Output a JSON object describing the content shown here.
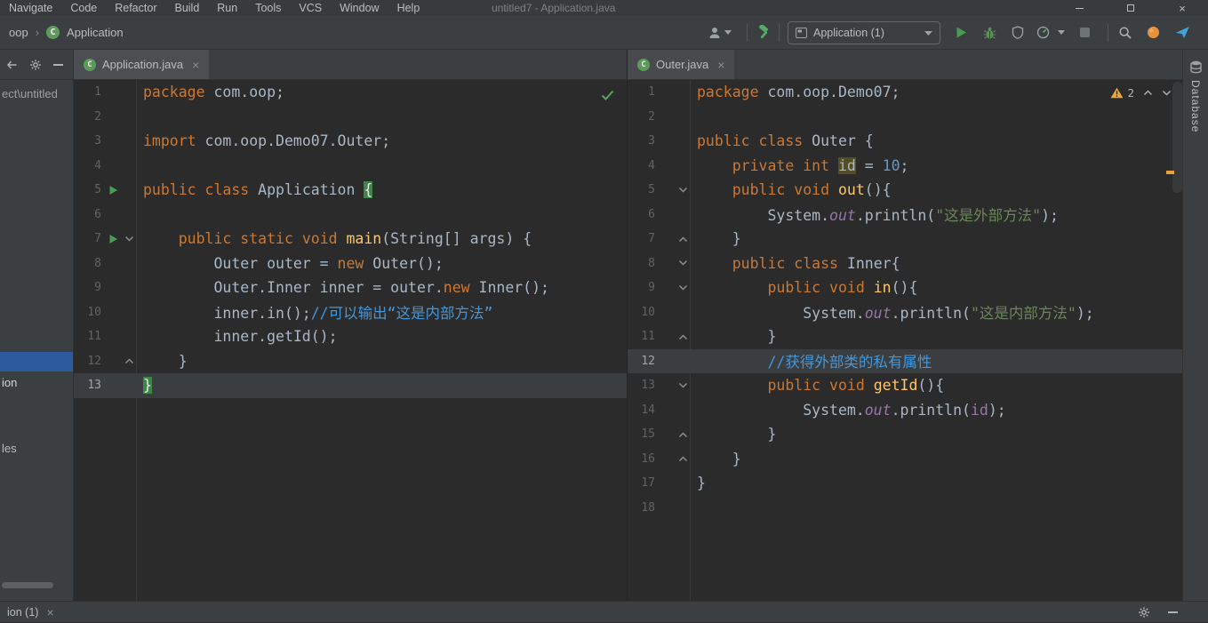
{
  "window": {
    "title": "untitled7 - Application.java",
    "menu_items": [
      "Navigate",
      "Code",
      "Refactor",
      "Build",
      "Run",
      "Tools",
      "VCS",
      "Window",
      "Help"
    ]
  },
  "icons": {
    "class_letter": "C"
  },
  "toolbar": {
    "breadcrumb_module": "oop",
    "breadcrumb_separator": "›",
    "breadcrumb_class": "Application",
    "run_config_label": "Application (1)"
  },
  "project_panel": {
    "top_item": "ect\\untitled",
    "mid_item": "ion",
    "low_item": "les"
  },
  "editor": {
    "left_pane": {
      "tab_label": "Application.java",
      "tab_close": "×",
      "current_line": 13,
      "run_lines": [
        5,
        7
      ],
      "fold_down_lines": [
        7
      ],
      "fold_up_lines": [
        12
      ],
      "lines": [
        [
          [
            "k",
            "package"
          ],
          [
            "d",
            " com.oop;"
          ]
        ],
        [],
        [
          [
            "k",
            "import"
          ],
          [
            "d",
            " com.oop.Demo07.Outer;"
          ]
        ],
        [],
        [
          [
            "k",
            "public class"
          ],
          [
            "d",
            " Application "
          ],
          [
            "bm",
            "{"
          ]
        ],
        [],
        [
          [
            "d",
            "    "
          ],
          [
            "k",
            "public static void"
          ],
          [
            "d",
            " "
          ],
          [
            "m",
            "main"
          ],
          [
            "d",
            "(String[] args) {"
          ]
        ],
        [
          [
            "d",
            "        Outer outer = "
          ],
          [
            "k",
            "new"
          ],
          [
            "d",
            " Outer();"
          ]
        ],
        [
          [
            "d",
            "        Outer.Inner inner = outer."
          ],
          [
            "k",
            "new"
          ],
          [
            "d",
            " Inner();"
          ]
        ],
        [
          [
            "d",
            "        inner.in();"
          ],
          [
            "c",
            "//可以输出“这是内部方法”"
          ]
        ],
        [
          [
            "d",
            "        inner.getId();"
          ]
        ],
        [
          [
            "d",
            "    }"
          ]
        ],
        [
          [
            "bm",
            "}"
          ]
        ]
      ]
    },
    "right_pane": {
      "tab_label": "Outer.java",
      "tab_close": "×",
      "warnings": "2",
      "current_line": 12,
      "run_lines": [],
      "fold_down_lines": [
        5,
        8,
        9,
        13
      ],
      "fold_up_lines": [
        7,
        11,
        15,
        16
      ],
      "lines": [
        [
          [
            "k",
            "package"
          ],
          [
            "d",
            " com.oop.Demo07;"
          ]
        ],
        [],
        [
          [
            "k",
            "public class"
          ],
          [
            "d",
            " Outer {"
          ]
        ],
        [
          [
            "d",
            "    "
          ],
          [
            "k",
            "private int"
          ],
          [
            "d",
            " "
          ],
          [
            "hl",
            "id"
          ],
          [
            "d",
            " = "
          ],
          [
            "n",
            "10"
          ],
          [
            "d",
            ";"
          ]
        ],
        [
          [
            "d",
            "    "
          ],
          [
            "k",
            "public void"
          ],
          [
            "d",
            " "
          ],
          [
            "m",
            "out"
          ],
          [
            "d",
            "(){"
          ]
        ],
        [
          [
            "d",
            "        System."
          ],
          [
            "f",
            "out"
          ],
          [
            "d",
            ".println("
          ],
          [
            "s",
            "\"这是外部方法\""
          ],
          [
            "d",
            ");"
          ]
        ],
        [
          [
            "d",
            "    }"
          ]
        ],
        [
          [
            "d",
            "    "
          ],
          [
            "k",
            "public class"
          ],
          [
            "d",
            " Inner{"
          ]
        ],
        [
          [
            "d",
            "        "
          ],
          [
            "k",
            "public void"
          ],
          [
            "d",
            " "
          ],
          [
            "m",
            "in"
          ],
          [
            "d",
            "(){"
          ]
        ],
        [
          [
            "d",
            "            System."
          ],
          [
            "f",
            "out"
          ],
          [
            "d",
            ".println("
          ],
          [
            "s",
            "\"这是内部方法\""
          ],
          [
            "d",
            ");"
          ]
        ],
        [
          [
            "d",
            "        }"
          ]
        ],
        [
          [
            "d",
            "        "
          ],
          [
            "c",
            "//获得外部类的私有属性"
          ]
        ],
        [
          [
            "d",
            "        "
          ],
          [
            "k",
            "public void"
          ],
          [
            "d",
            " "
          ],
          [
            "m",
            "getId"
          ],
          [
            "d",
            "(){"
          ]
        ],
        [
          [
            "d",
            "            System."
          ],
          [
            "f",
            "out"
          ],
          [
            "d",
            ".println("
          ],
          [
            "fd",
            "id"
          ],
          [
            "d",
            ");"
          ]
        ],
        [
          [
            "d",
            "        }"
          ]
        ],
        [
          [
            "d",
            "    }"
          ]
        ],
        [
          [
            "d",
            "}"
          ]
        ],
        []
      ]
    }
  },
  "right_strip": {
    "database_label": "Database"
  },
  "bottom_bar": {
    "run_tab_label": "ion (1)",
    "run_tab_close": "×"
  },
  "colors": {
    "keyword": "#cc7832",
    "plain": "#a9b7c6",
    "string": "#6a8759",
    "number": "#6897bb",
    "comment": "#4596d9",
    "method": "#ffc66b",
    "field": "#9876aa",
    "brace_match_bg": "#3e8548",
    "id_highlight_bg": "#544c23",
    "run_green": "#499c54",
    "warning": "#e8a33d",
    "selection_blue": "#2d5a9e",
    "caret_row": "#3b3e41"
  }
}
